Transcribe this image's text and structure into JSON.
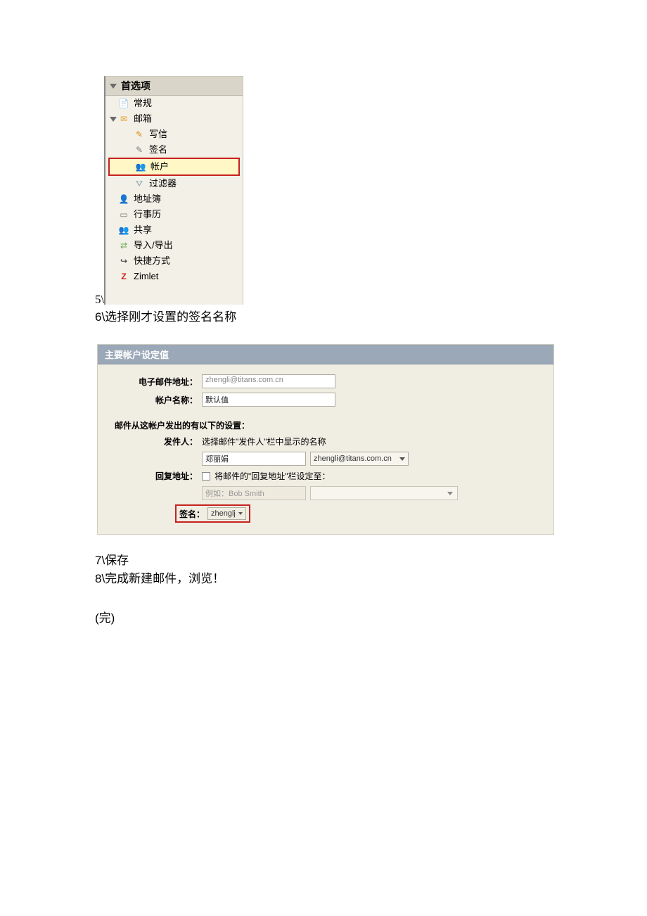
{
  "sidebar": {
    "header": "首选项",
    "items": [
      {
        "label": "常规",
        "icon": "📄"
      },
      {
        "label": "邮箱",
        "icon": "✉",
        "expandable": true
      },
      {
        "label": "写信",
        "icon": "✎",
        "child": true
      },
      {
        "label": "签名",
        "icon": "✎",
        "child": true
      },
      {
        "label": "帐户",
        "icon": "👥",
        "child": true,
        "highlight": true
      },
      {
        "label": "过滤器",
        "icon": "⛛",
        "child": true
      },
      {
        "label": "地址簿",
        "icon": "👤"
      },
      {
        "label": "行事历",
        "icon": "▭"
      },
      {
        "label": "共享",
        "icon": "👥"
      },
      {
        "label": "导入/导出",
        "icon": "⇄"
      },
      {
        "label": "快捷方式",
        "icon": "↪"
      },
      {
        "label": "Zimlet",
        "icon": "Z"
      }
    ]
  },
  "steps": {
    "s5": "5\\",
    "s6": "6\\选择刚才设置的签名名称",
    "s7": "7\\保存",
    "s8": "8\\完成新建邮件，浏览！",
    "end": "(完)"
  },
  "panel": {
    "title": "主要帐户设定值",
    "email_label": "电子邮件地址：",
    "email_value": "zhengli@titans.com.cn",
    "name_label": "帐户名称：",
    "name_value": "默认值",
    "section2": "邮件从这帐户发出的有以下的设置：",
    "sender_label": "发件人：",
    "sender_desc": "选择邮件\"发件人\"栏中显示的名称",
    "sender_name": "郑丽娟",
    "sender_email": "zhengli@titans.com.cn",
    "reply_label": "回复地址：",
    "reply_chk_text": "将邮件的\"回复地址\"栏设定至：",
    "reply_placeholder": "例如：Bob Smith",
    "sig_label": "签名：",
    "sig_value": "zhenglj"
  }
}
